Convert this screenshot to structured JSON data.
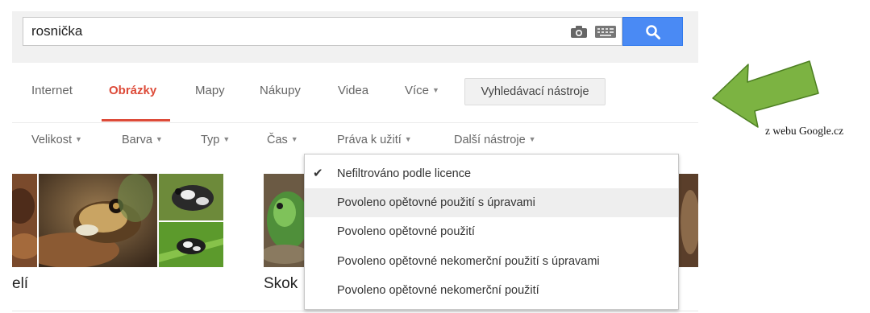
{
  "search": {
    "query": "rosnička"
  },
  "tabs": [
    {
      "label": "Internet"
    },
    {
      "label": "Obrázky"
    },
    {
      "label": "Mapy"
    },
    {
      "label": "Nákupy"
    },
    {
      "label": "Videa"
    },
    {
      "label": "Více"
    }
  ],
  "tools_button": "Vyhledávací nástroje",
  "filters": [
    {
      "label": "Velikost"
    },
    {
      "label": "Barva"
    },
    {
      "label": "Typ"
    },
    {
      "label": "Čas"
    },
    {
      "label": "Práva k užití"
    },
    {
      "label": "Další nástroje"
    }
  ],
  "rights_menu": {
    "items": [
      {
        "label": "Nefiltrováno podle licence",
        "checked": true
      },
      {
        "label": "Povoleno opětovné použití s úpravami",
        "highlighted": true
      },
      {
        "label": "Povoleno opětovné použití"
      },
      {
        "label": "Povoleno opětovné nekomerční použití s úpravami"
      },
      {
        "label": "Povoleno opětovné nekomerční použití"
      }
    ]
  },
  "results": [
    {
      "caption": "elí"
    },
    {
      "caption": "Skok"
    }
  ],
  "source_note": "z webu Google.cz",
  "colors": {
    "accent_red": "#dd4b39",
    "search_blue": "#4a8af4",
    "arrow_green": "#7cb342"
  }
}
